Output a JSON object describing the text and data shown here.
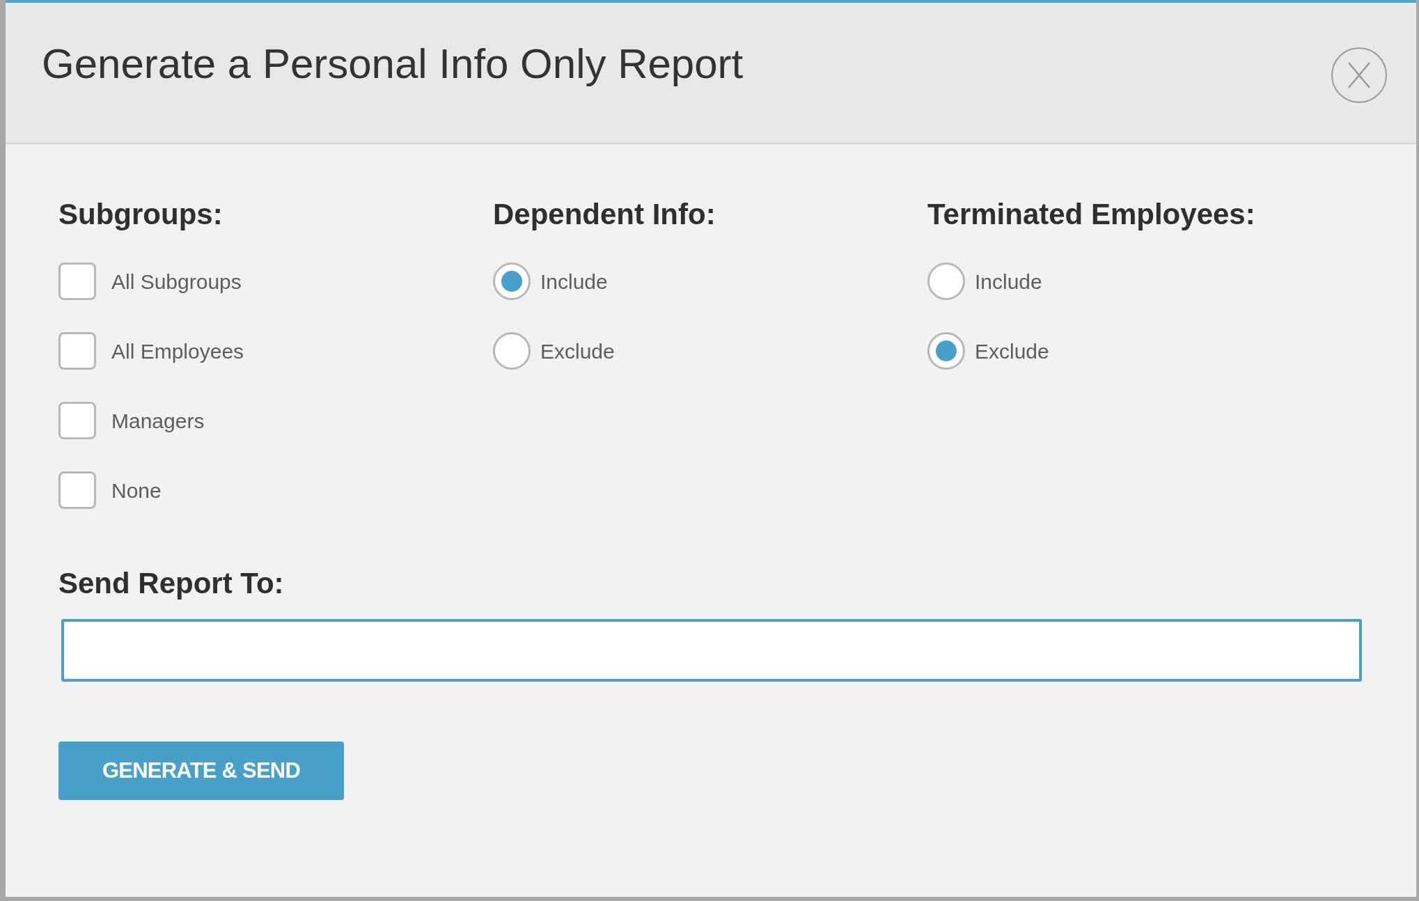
{
  "dialog": {
    "title": "Generate a Personal Info Only Report"
  },
  "subgroups": {
    "heading": "Subgroups:",
    "options": [
      {
        "label": "All Subgroups",
        "checked": false
      },
      {
        "label": "All Employees",
        "checked": false
      },
      {
        "label": "Managers",
        "checked": false
      },
      {
        "label": "None",
        "checked": false
      }
    ]
  },
  "dependent_info": {
    "heading": "Dependent Info:",
    "options": [
      {
        "label": "Include",
        "selected": true
      },
      {
        "label": "Exclude",
        "selected": false
      }
    ]
  },
  "terminated_employees": {
    "heading": "Terminated Employees:",
    "options": [
      {
        "label": "Include",
        "selected": false
      },
      {
        "label": "Exclude",
        "selected": true
      }
    ]
  },
  "send_report_to": {
    "heading": "Send Report To:"
  },
  "submit_button": {
    "label": "GENERATE & SEND"
  }
}
